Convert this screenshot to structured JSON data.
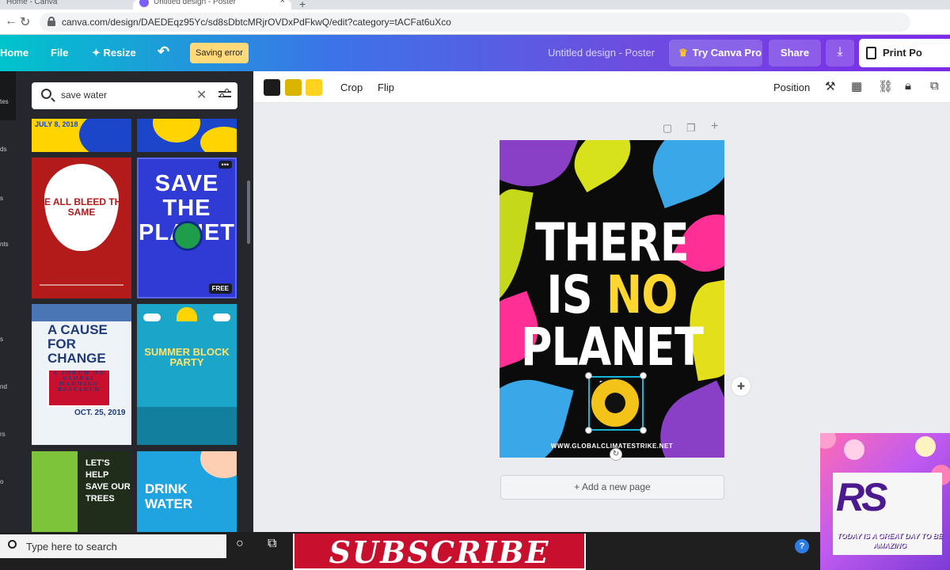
{
  "browser": {
    "tabs": [
      "Home - Canva",
      "Untitled design - Poster"
    ],
    "new_tab": "+",
    "close_tab": "×",
    "back": "←",
    "reload": "↻",
    "url": "canva.com/design/DAEDEqz95Yc/sd8sDbtcMRjrOVDxPdFkwQ/edit?category=tACFat6uXco"
  },
  "topbar": {
    "home": "Home",
    "file": "File",
    "resize": "Resize",
    "resize_icon": "✦",
    "undo": "↶",
    "saving_status": "Saving error",
    "design_title": "Untitled design - Poster",
    "try_pro": "Try Canva Pro",
    "crown_icon": "♛",
    "share": "Share",
    "download_icon": "⤓",
    "print": "Print Po"
  },
  "rail": {
    "labels": [
      "tes",
      "ds",
      "s",
      "nts",
      "s",
      "nd",
      "rs",
      "o"
    ]
  },
  "search": {
    "value": "save water",
    "clear": "✕"
  },
  "templates": {
    "top1_text": "JULY 8, 2018",
    "bleed": "WE ALL BLEED THE SAME",
    "planet": "SAVE THE PLANET",
    "planet_badge": "FREE",
    "planet_menu": "•••",
    "cause": "A CAUSE FOR CHANGE",
    "cause_sub": "A FORUM ON GLOBAL WARMING RESEARCH",
    "cause_date": "OCT. 25, 2019",
    "party": "SUMMER BLOCK PARTY",
    "trees": "LET'S HELP SAVE OUR TREES",
    "water": "DRINK WATER"
  },
  "panel": {
    "collapse": "‹"
  },
  "toolbar": {
    "swatches": [
      "#1b1b1b",
      "#d9b400",
      "#ffd21f"
    ],
    "crop": "Crop",
    "flip": "Flip",
    "position": "Position",
    "icons": [
      "paint-roller-icon",
      "transparency-icon",
      "link-icon",
      "lock-icon",
      "copy-style-icon"
    ]
  },
  "canvas_icons": {
    "note": "▢",
    "duplicate": "❐",
    "add": "+"
  },
  "poster": {
    "line1": "THERE",
    "line2_a": "IS ",
    "line2_b": "NO",
    "line3": "PLANET B",
    "url": "WWW.GLOBALCLIMATESTRIKE.NET",
    "accent": "#ffd72e"
  },
  "canvas": {
    "add_page": "+ Add a new page",
    "rotate_icon": "↻",
    "comment_icon": "✚"
  },
  "overlay": {
    "logo": "RS",
    "tagline": "TODAY IS A GREAT DAY TO BE AMAZING"
  },
  "taskbar": {
    "search_placeholder": "Type here to search",
    "cortana": "○",
    "task_view": "⧉",
    "subscribe": "SUBSCRIBE",
    "tray_icon": "?"
  }
}
